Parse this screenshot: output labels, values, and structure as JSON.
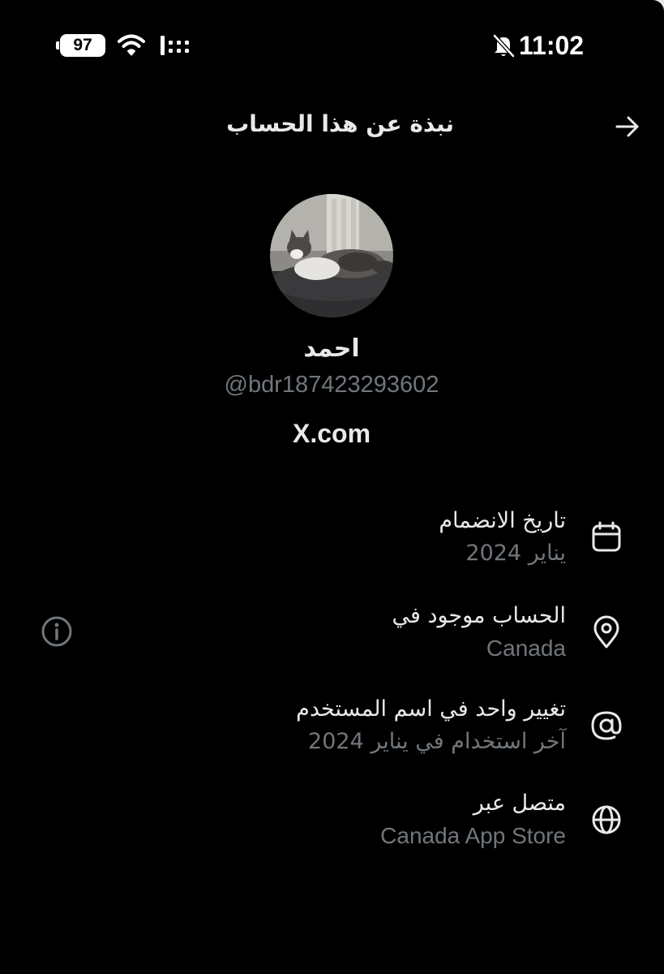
{
  "status_bar": {
    "battery_level": "97",
    "time": "11:02",
    "icons": [
      "wifi-icon",
      "signal-icon",
      "bell-off-icon"
    ]
  },
  "header": {
    "title": "نبذة عن هذا الحساب",
    "back_icon": "arrow-right-icon"
  },
  "profile": {
    "display_name": "احمد",
    "handle": "@bdr187423293602",
    "domain": "X.com"
  },
  "rows": [
    {
      "label": "تاريخ الانضمام",
      "value": "يناير 2024",
      "icon": "calendar-icon"
    },
    {
      "label": "الحساب موجود في",
      "value": "Canada",
      "icon": "location-pin-icon"
    },
    {
      "label": "تغيير واحد في اسم المستخدم",
      "value": "آخر استخدام في يناير 2024",
      "icon": "at-sign-icon"
    },
    {
      "label": "متصل عبر",
      "value": "Canada App Store",
      "icon": "globe-icon"
    }
  ],
  "info_icon": "info-icon",
  "colors": {
    "background": "#000000",
    "primary_text": "#e7e9ea",
    "secondary_text": "#71767b"
  }
}
